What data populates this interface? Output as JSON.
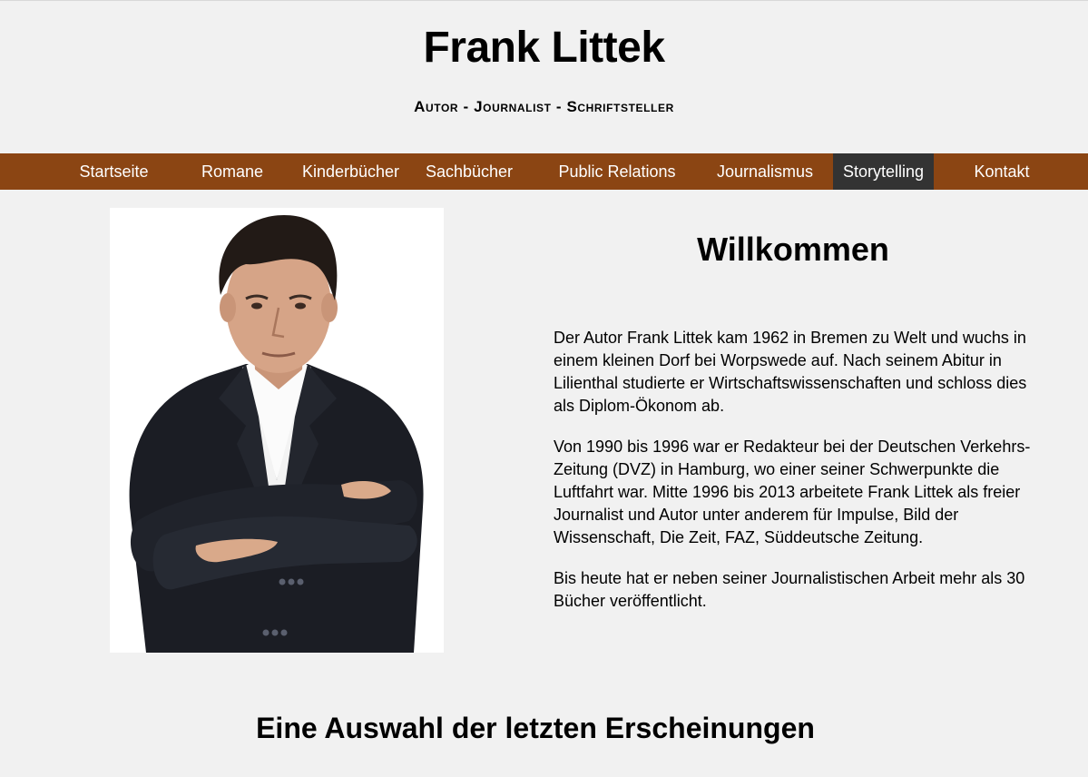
{
  "header": {
    "title": "Frank Littek",
    "subtitle": "Autor - Journalist - Schriftsteller"
  },
  "nav": {
    "items": [
      {
        "label": "Startseite",
        "active": false
      },
      {
        "label": "Romane",
        "active": false
      },
      {
        "label": "Kinderbücher",
        "active": false
      },
      {
        "label": "Sachbücher",
        "active": false
      },
      {
        "label": "Public Relations",
        "active": false
      },
      {
        "label": "Journalismus",
        "active": false
      },
      {
        "label": "Storytelling",
        "active": true
      },
      {
        "label": "Kontakt",
        "active": false
      }
    ]
  },
  "colors": {
    "nav_background": "#8b4513",
    "nav_active_background": "#333333",
    "page_background": "#f1f1f1"
  },
  "main": {
    "welcome_title": "Willkommen",
    "paragraphs": [
      "Der Autor Frank Littek kam 1962 in Bremen zu Welt und wuchs in einem kleinen Dorf bei Worpswede auf. Nach seinem Abitur in Lilienthal studierte er Wirtschaftswissenschaften und schloss dies als Diplom-Ökonom ab.",
      "Von 1990 bis 1996 war er Redakteur bei der Deutschen Verkehrs-Zeitung (DVZ) in Hamburg, wo einer seiner Schwerpunkte die Luftfahrt war. Mitte 1996 bis 2013 arbeitete Frank Littek als freier Journalist und Autor unter anderem für Impulse, Bild der Wissenschaft, Die Zeit, FAZ, Süddeutsche Zeitung.",
      "Bis heute hat er neben seiner Journalistischen Arbeit mehr als 30 Bücher veröffentlicht."
    ]
  },
  "recent": {
    "title": "Eine Auswahl der letzten Erscheinungen"
  }
}
